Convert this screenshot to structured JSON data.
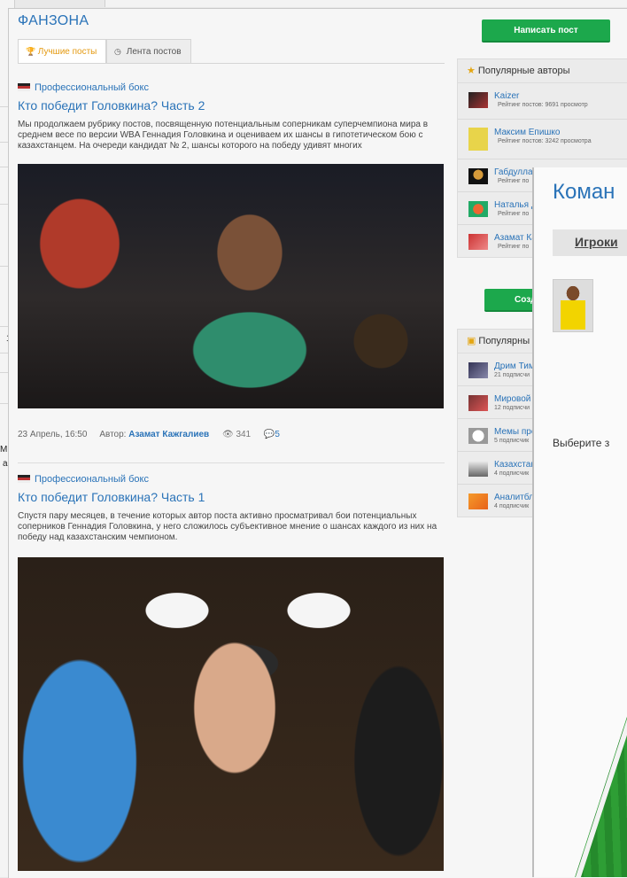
{
  "header": {
    "title": "ФАНЗОНА"
  },
  "tabs": [
    {
      "label": "Лучшие посты",
      "active": true,
      "icon": "trophy-icon"
    },
    {
      "label": "Лента постов",
      "active": false,
      "icon": "clock-icon"
    }
  ],
  "actions": {
    "write_post": "Написать пост",
    "create_partial": "Созд"
  },
  "posts": [
    {
      "category": "Профессиональный бокс",
      "title": "Кто победит Головкина? Часть 2",
      "excerpt": "Мы продолжаем рубрику постов, посвященную потенциальным соперникам суперчемпиона мира в среднем весе по версии WBA Геннадия Головкина и оцениваем их шансы в гипотетическом бою с казахстанцем. На очереди кандидат № 2, шансы которого на победу удивят многих",
      "date": "23 Апрель, 16:50",
      "author_label": "Автор:",
      "author": "Азамат Кажгалиев",
      "views": "341",
      "comments": "5"
    },
    {
      "category": "Профессиональный бокс",
      "title": "Кто победит Головкина? Часть 1",
      "excerpt": "Спустя пару месяцев, в течение которых автор поста активно просматривал бои потенциальных соперников Геннадия Головкина, у него сложилось субъективное мнение о шансах каждого из них на победу над казахстанским чемпионом."
    }
  ],
  "popular_authors": {
    "title": "Популярные авторы",
    "items": [
      {
        "name": "Kaizer",
        "sub": "Рейтинг постов: 9691 просмотр"
      },
      {
        "name": "Максим Епишко",
        "sub": "Рейтинг постов: 3242 просмотра"
      },
      {
        "name": "Габдулла",
        "sub": "Рейтинг по"
      },
      {
        "name": "Наталья Д",
        "sub": "Рейтинг по"
      },
      {
        "name": "Азамат Ка",
        "sub": "Рейтинг по"
      }
    ]
  },
  "popular_blogs": {
    "title": "Популярны",
    "items": [
      {
        "name": "Дрим Тим",
        "sub": "21 подписчи"
      },
      {
        "name": "Мировой",
        "sub": "12 подписчи"
      },
      {
        "name": "Мемы про",
        "sub": "5 подписчик"
      },
      {
        "name": "Казахстан",
        "sub": "4 подписчик"
      },
      {
        "name": "Аналитбл",
        "sub": "4 подписчик"
      }
    ]
  },
  "modal": {
    "title": "Коман",
    "tab": "Игроки",
    "hint": "Выберите з"
  },
  "background_fragments": [
    "1",
    "а",
    "ва",
    "М"
  ],
  "colors": {
    "accent": "#2a73b8",
    "button": "#1ca84c",
    "active_tab": "#e49a12"
  }
}
